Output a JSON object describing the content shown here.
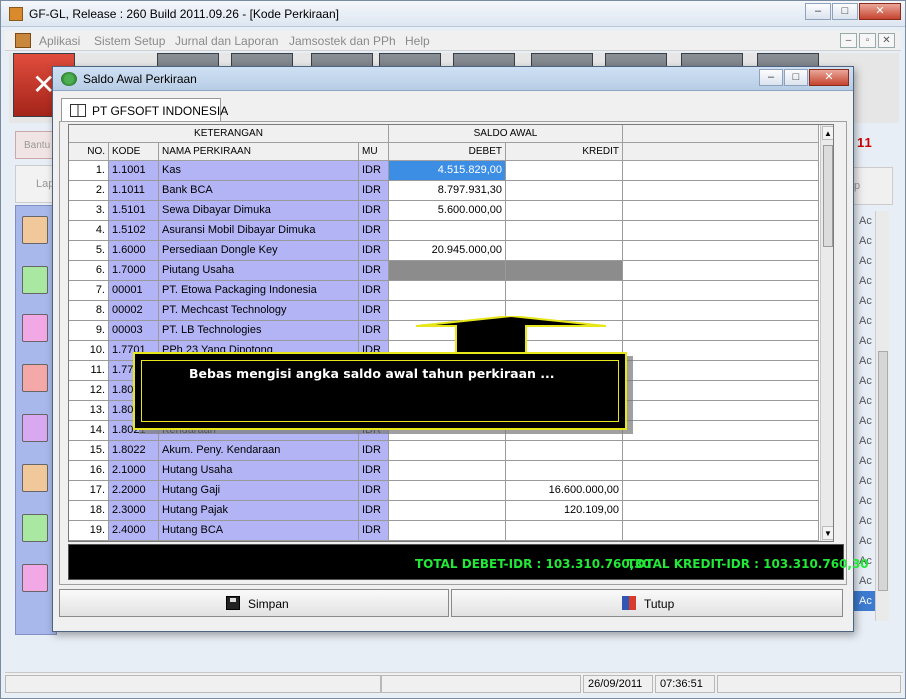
{
  "main": {
    "title": "GF-GL, Release : 260 Build 2011.09.26 - [Kode Perkiraan]",
    "menu": [
      "Aplikasi",
      "Sistem Setup",
      "Jurnal dan Laporan",
      "Jamsostek dan PPh",
      "Help"
    ],
    "left_buttons": {
      "bantu": "Bantu",
      "lap": "Lap"
    },
    "right_label": "11",
    "right_button": "p",
    "right_items": [
      "Ac",
      "Ac",
      "Ac",
      "Ac",
      "Ac",
      "Ac",
      "Ac",
      "Ac",
      "Ac",
      "Ac",
      "Ac",
      "Ac",
      "Ac",
      "Ac",
      "Ac",
      "Ac",
      "Ac",
      "Ac",
      "Ac",
      "Ac"
    ],
    "status": {
      "date": "26/09/2011",
      "time": "07:36:51"
    }
  },
  "dialog": {
    "title": "Saldo Awal Perkiraan",
    "tab": "PT GFSOFT INDONESIA",
    "headers": {
      "keterangan": "KETERANGAN",
      "saldo_awal": "SALDO AWAL",
      "no": "NO.",
      "kode": "KODE",
      "nama": "NAMA PERKIRAAN",
      "mu": "MU",
      "debet": "DEBET",
      "kredit": "KREDIT"
    },
    "rows": [
      {
        "no": "1.",
        "kode": "1.1001",
        "nama": "Kas",
        "mu": "IDR",
        "debet": "4.515.829,00",
        "kredit": ""
      },
      {
        "no": "2.",
        "kode": "1.1011",
        "nama": "Bank BCA",
        "mu": "IDR",
        "debet": "8.797.931,30",
        "kredit": ""
      },
      {
        "no": "3.",
        "kode": "1.5101",
        "nama": "Sewa Dibayar Dimuka",
        "mu": "IDR",
        "debet": "5.600.000,00",
        "kredit": ""
      },
      {
        "no": "4.",
        "kode": "1.5102",
        "nama": "Asuransi Mobil Dibayar Dimuka",
        "mu": "IDR",
        "debet": "",
        "kredit": ""
      },
      {
        "no": "5.",
        "kode": "1.6000",
        "nama": "Persediaan Dongle Key",
        "mu": "IDR",
        "debet": "20.945.000,00",
        "kredit": ""
      },
      {
        "no": "6.",
        "kode": "1.7000",
        "nama": "Piutang Usaha",
        "mu": "IDR",
        "debet": "",
        "kredit": ""
      },
      {
        "no": "7.",
        "kode": "00001",
        "nama": "PT. Etowa Packaging Indonesia",
        "mu": "IDR",
        "debet": "",
        "kredit": ""
      },
      {
        "no": "8.",
        "kode": "00002",
        "nama": "PT. Mechcast Technology",
        "mu": "IDR",
        "debet": "",
        "kredit": ""
      },
      {
        "no": "9.",
        "kode": "00003",
        "nama": "PT. LB Technologies",
        "mu": "IDR",
        "debet": "",
        "kredit": ""
      },
      {
        "no": "10.",
        "kode": "1.7701",
        "nama": "PPh 23 Yang Dipotong",
        "mu": "IDR",
        "debet": "",
        "kredit": ""
      },
      {
        "no": "11.",
        "kode": "1.77",
        "nama": "",
        "mu": "IDR",
        "debet": "",
        "kredit": ""
      },
      {
        "no": "12.",
        "kode": "1.80",
        "nama": "",
        "mu": "IDR",
        "debet": "",
        "kredit": ""
      },
      {
        "no": "13.",
        "kode": "1.80",
        "nama": "",
        "mu": "IDR",
        "debet": "",
        "kredit": ""
      },
      {
        "no": "14.",
        "kode": "1.8021",
        "nama": "Kendaraan",
        "mu": "IDR",
        "debet": "",
        "kredit": ""
      },
      {
        "no": "15.",
        "kode": "1.8022",
        "nama": "Akum. Peny. Kendaraan",
        "mu": "IDR",
        "debet": "",
        "kredit": ""
      },
      {
        "no": "16.",
        "kode": "2.1000",
        "nama": "Hutang Usaha",
        "mu": "IDR",
        "debet": "",
        "kredit": ""
      },
      {
        "no": "17.",
        "kode": "2.2000",
        "nama": "Hutang Gaji",
        "mu": "IDR",
        "debet": "",
        "kredit": "16.600.000,00"
      },
      {
        "no": "18.",
        "kode": "2.3000",
        "nama": "Hutang Pajak",
        "mu": "IDR",
        "debet": "",
        "kredit": "120.109,00"
      },
      {
        "no": "19.",
        "kode": "2.4000",
        "nama": "Hutang BCA",
        "mu": "IDR",
        "debet": "",
        "kredit": ""
      }
    ],
    "total_debet": "TOTAL DEBET-IDR : 103.310.760,30",
    "total_kredit": "TOTAL KREDIT-IDR : 103.310.760,30",
    "buttons": {
      "simpan": "Simpan",
      "tutup": "Tutup"
    },
    "callout": "Bebas mengisi angka saldo awal tahun perkiraan ..."
  },
  "colors": {
    "row_highlight": "#b3b4f5",
    "selected_cell": "#3c8ee4",
    "totals_text": "#22e838",
    "callout_border": "#e6e61a"
  }
}
